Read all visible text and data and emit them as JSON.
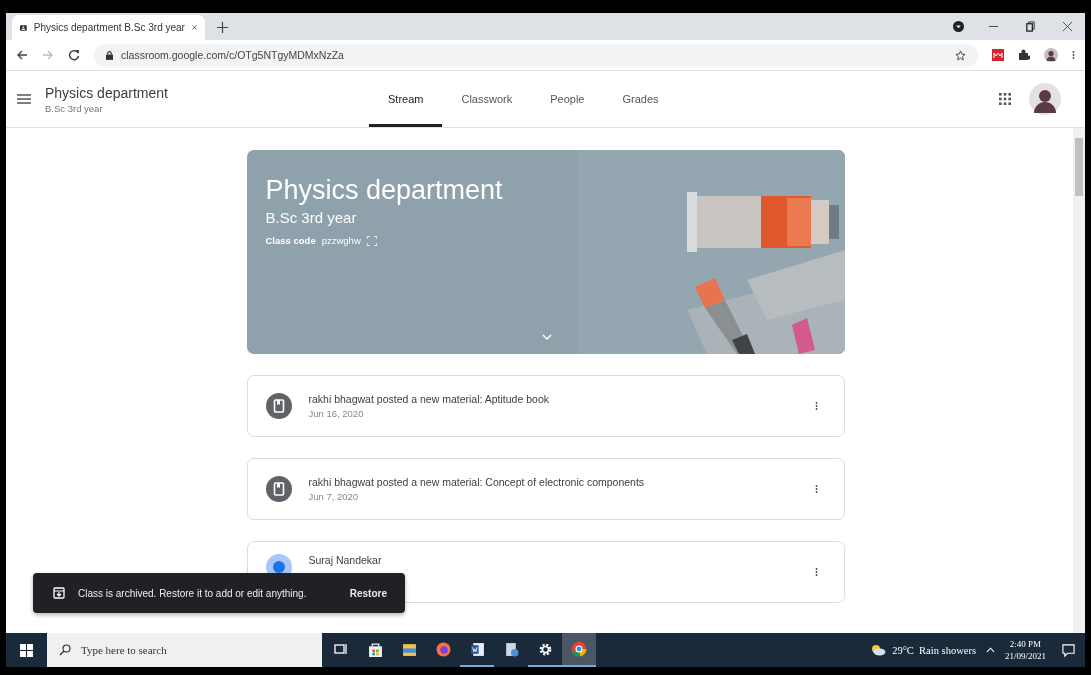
{
  "browser": {
    "tab_title": "Physics department B.Sc 3rd year",
    "url": "classroom.google.com/c/OTg5NTgyMDMxNzZa"
  },
  "header": {
    "title": "Physics department",
    "subtitle": "B.Sc 3rd year"
  },
  "tabs": [
    {
      "label": "Stream",
      "selected": true
    },
    {
      "label": "Classwork",
      "selected": false
    },
    {
      "label": "People",
      "selected": false
    },
    {
      "label": "Grades",
      "selected": false
    }
  ],
  "banner": {
    "title": "Physics department",
    "subtitle": "B.Sc 3rd year",
    "class_code_label": "Class code",
    "class_code": "pzzwghw"
  },
  "posts": [
    {
      "kind": "material",
      "text": "rakhi bhagwat posted a new material: Aptitude book",
      "date": "Jun 16, 2020"
    },
    {
      "kind": "material",
      "text": "rakhi bhagwat posted a new material: Concept of electronic components",
      "date": "Jun 7, 2020"
    },
    {
      "kind": "person",
      "author": "Suraj Nandekar"
    }
  ],
  "snackbar": {
    "message": "Class is archived. Restore it to add or edit anything.",
    "action": "Restore"
  },
  "taskbar": {
    "search_placeholder": "Type here to search",
    "apps": [
      {
        "kind": "taskview",
        "open": false,
        "selected": false
      },
      {
        "kind": "store",
        "open": false,
        "selected": false
      },
      {
        "kind": "explorer",
        "open": false,
        "selected": false
      },
      {
        "kind": "firefox",
        "open": false,
        "selected": false
      },
      {
        "kind": "word",
        "open": true,
        "selected": false
      },
      {
        "kind": "notes",
        "open": false,
        "selected": false
      },
      {
        "kind": "settings",
        "open": true,
        "selected": false
      },
      {
        "kind": "chrome",
        "open": true,
        "selected": true
      }
    ],
    "weather": "29°C  Rain showers",
    "time": "2:40 PM",
    "date": "21/09/2021"
  }
}
